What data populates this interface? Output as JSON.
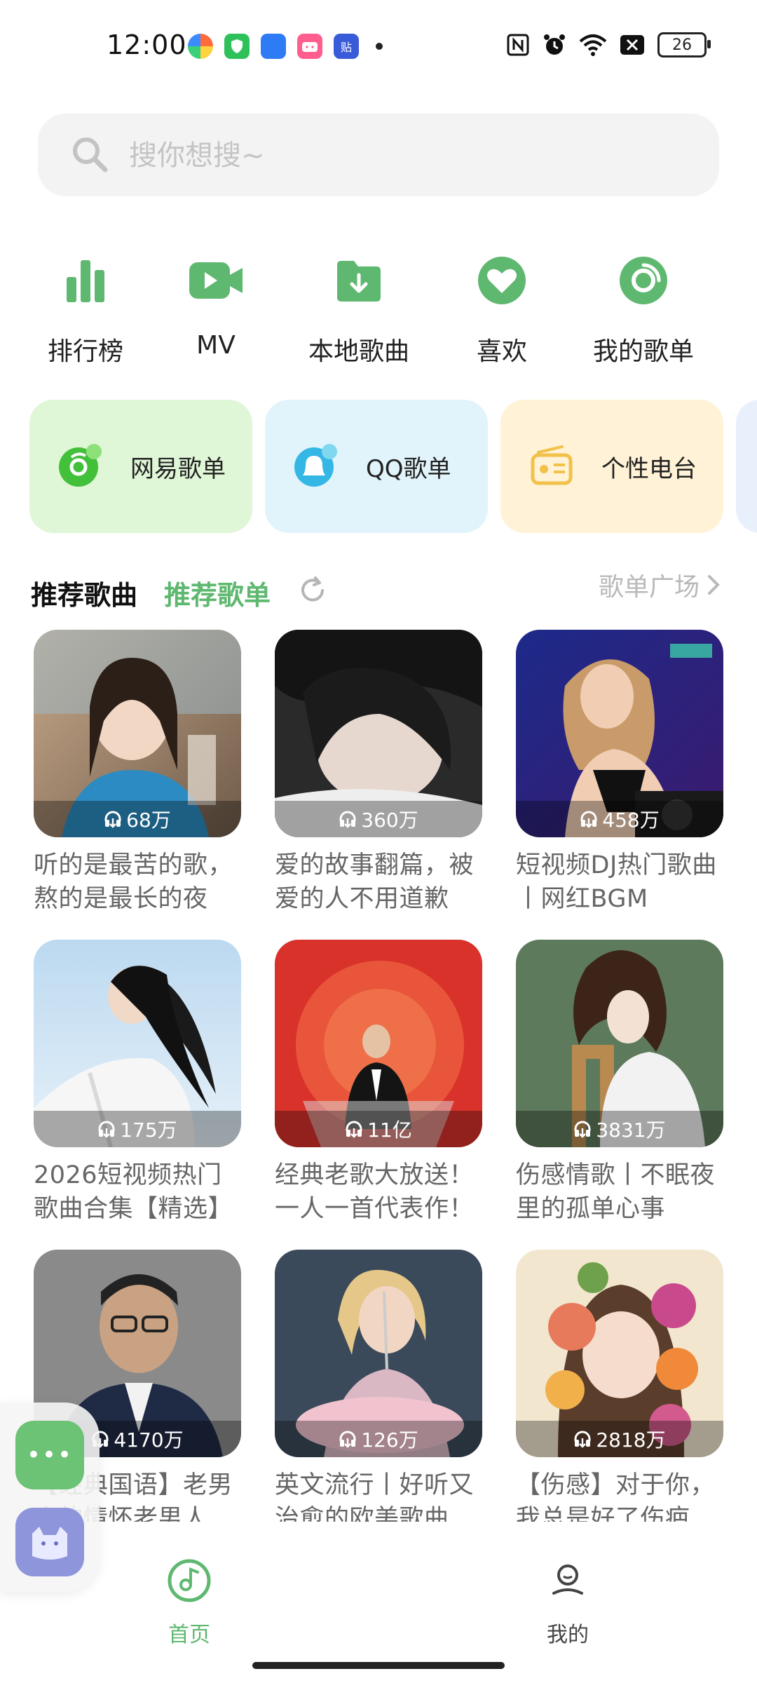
{
  "status_bar": {
    "time": "12:00",
    "app_icons": [
      "speed-icon",
      "shield-icon",
      "blue-app-icon",
      "bilibili-icon",
      "tieba-icon"
    ],
    "right_icons": [
      "nfc-icon",
      "alarm-icon",
      "wifi-icon",
      "x-icon"
    ],
    "battery": "26"
  },
  "search": {
    "placeholder": "搜你想搜~"
  },
  "quick_nav": [
    {
      "label": "排行榜",
      "icon": "chart-icon"
    },
    {
      "label": "MV",
      "icon": "video-icon"
    },
    {
      "label": "本地歌曲",
      "icon": "folder-download-icon"
    },
    {
      "label": "喜欢",
      "icon": "heart-icon"
    },
    {
      "label": "我的歌单",
      "icon": "disc-icon"
    }
  ],
  "source_cards": [
    {
      "label": "网易歌单",
      "icon": "netease-icon",
      "bg": "#dff6d7"
    },
    {
      "label": "QQ歌单",
      "icon": "qq-icon",
      "bg": "#e2f4fb"
    },
    {
      "label": "个性电台",
      "icon": "radio-icon",
      "bg": "#fff2d6"
    }
  ],
  "section": {
    "tab_songs": "推荐歌曲",
    "tab_playlists": "推荐歌单",
    "plaza_link": "歌单广场"
  },
  "playlists": [
    {
      "count": "68万",
      "title": "听的是最苦的歌，熬的是最长的夜"
    },
    {
      "count": "360万",
      "title": "爱的故事翻篇，被爱的人不用道歉"
    },
    {
      "count": "458万",
      "title": "短视频DJ热门歌曲丨网红BGM"
    },
    {
      "count": "175万",
      "title": "2026短视频热门歌曲合集【精选】"
    },
    {
      "count": "11亿",
      "title": "经典老歌大放送！一人一首代表作！"
    },
    {
      "count": "3831万",
      "title": "伤感情歌丨不眠夜里的孤单心事"
    },
    {
      "count": "4170万",
      "title": "【经典国语】老男人的情怀老男人"
    },
    {
      "count": "126万",
      "title": "英文流行丨好听又治愈的欧美歌曲"
    },
    {
      "count": "2818万",
      "title": "【伤感】对于你，我总是好了伤疤"
    }
  ],
  "bottom_nav": [
    {
      "label": "首页",
      "icon": "home-music-icon",
      "active": true
    },
    {
      "label": "我的",
      "icon": "profile-icon",
      "active": false
    }
  ],
  "colors": {
    "accent": "#5fb870",
    "inactive": "#444444"
  }
}
